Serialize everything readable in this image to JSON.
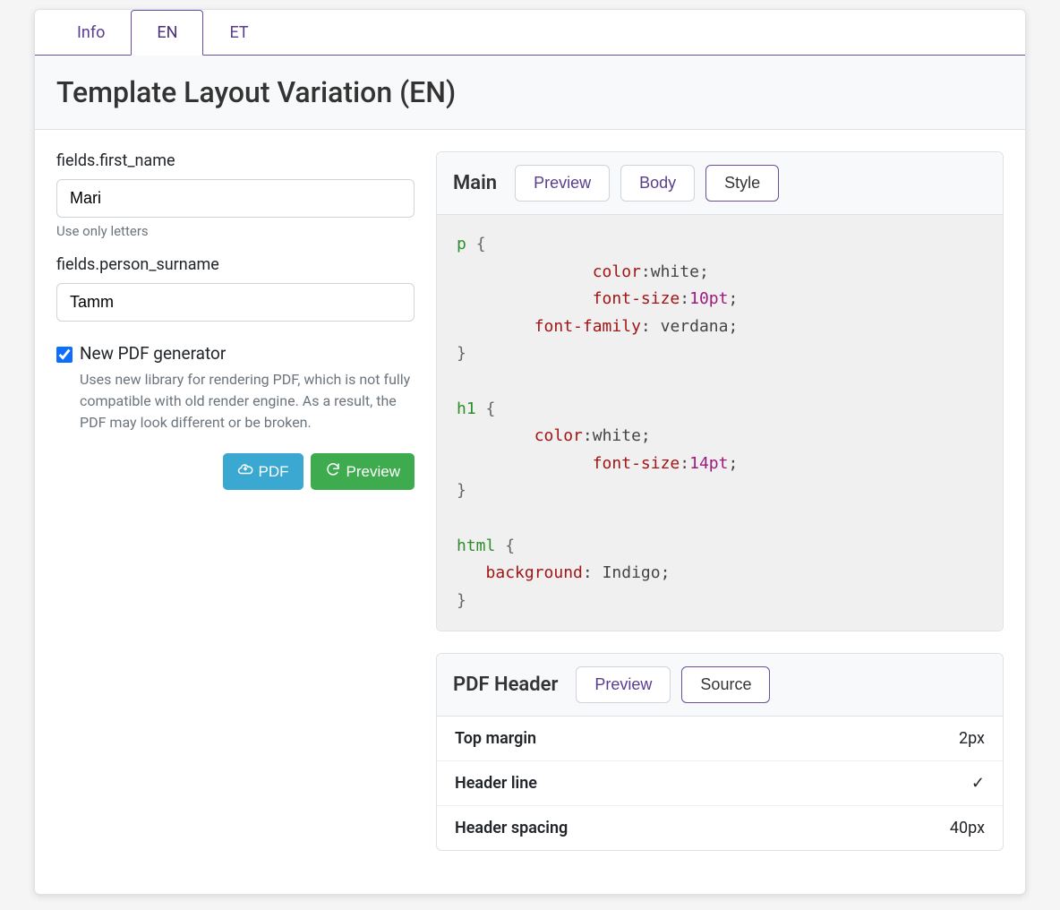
{
  "tabs": {
    "info": "Info",
    "en": "EN",
    "et": "ET",
    "active": "en"
  },
  "title": "Template Layout Variation (EN)",
  "fields": {
    "first_name": {
      "label": "fields.first_name",
      "value": "Mari",
      "help": "Use only letters"
    },
    "surname": {
      "label": "fields.person_surname",
      "value": "Tamm"
    }
  },
  "checkbox": {
    "label": "New PDF generator",
    "checked": true,
    "desc": "Uses new library for rendering PDF, which is not fully compatible with old render engine. As a result, the PDF may look different or be broken."
  },
  "buttons": {
    "pdf": "PDF",
    "preview": "Preview"
  },
  "main_panel": {
    "title": "Main",
    "tabs": {
      "preview": "Preview",
      "body": "Body",
      "style": "Style"
    },
    "css": {
      "p": [
        {
          "prop": "color",
          "val": "white"
        },
        {
          "prop": "font-size",
          "val": "10pt"
        },
        {
          "prop": "font-family",
          "val": " verdana"
        }
      ],
      "h1": [
        {
          "prop": "color",
          "val": "white"
        },
        {
          "prop": "font-size",
          "val": "14pt"
        }
      ],
      "html": [
        {
          "prop": "background",
          "val": " Indigo"
        }
      ]
    }
  },
  "pdf_header": {
    "title": "PDF Header",
    "tabs": {
      "preview": "Preview",
      "source": "Source"
    },
    "rows": [
      {
        "k": "Top margin",
        "v": "2px"
      },
      {
        "k": "Header line",
        "v": "✓"
      },
      {
        "k": "Header spacing",
        "v": "40px"
      }
    ]
  }
}
